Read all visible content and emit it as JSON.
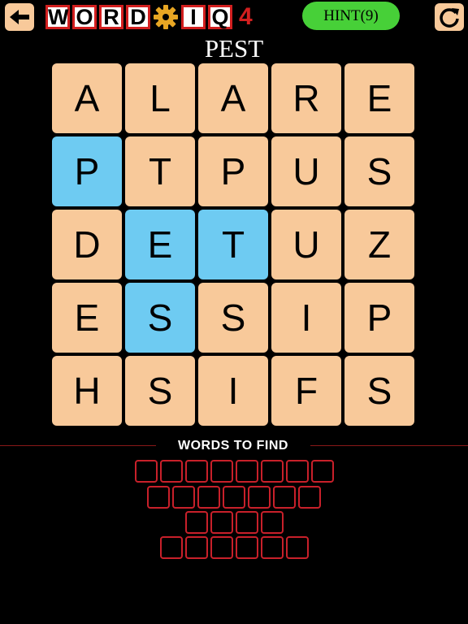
{
  "header": {
    "logo_letters": [
      "W",
      "O",
      "R",
      "D",
      "I",
      "Q"
    ],
    "logo_gear_icon": "gear-icon",
    "level": "4",
    "hint_label": "HINT(9)",
    "back_icon": "arrow-left-icon",
    "refresh_icon": "refresh-icon",
    "accent_color": "#d21f1f",
    "hint_color": "#47d038"
  },
  "current_word": "PEST",
  "board": {
    "rows": [
      [
        "A",
        "L",
        "A",
        "R",
        "E"
      ],
      [
        "P",
        "T",
        "P",
        "U",
        "S"
      ],
      [
        "D",
        "E",
        "T",
        "U",
        "Z"
      ],
      [
        "E",
        "S",
        "S",
        "I",
        "P"
      ],
      [
        "H",
        "S",
        "I",
        "F",
        "S"
      ]
    ],
    "selected": [
      [
        1,
        0
      ],
      [
        2,
        1
      ],
      [
        2,
        2
      ],
      [
        3,
        1
      ]
    ],
    "tile_color": "#f8c99a",
    "selected_color": "#6ecbf2"
  },
  "words_section": {
    "heading": "WORDS TO FIND",
    "word_lengths": [
      8,
      7,
      4,
      6
    ]
  }
}
